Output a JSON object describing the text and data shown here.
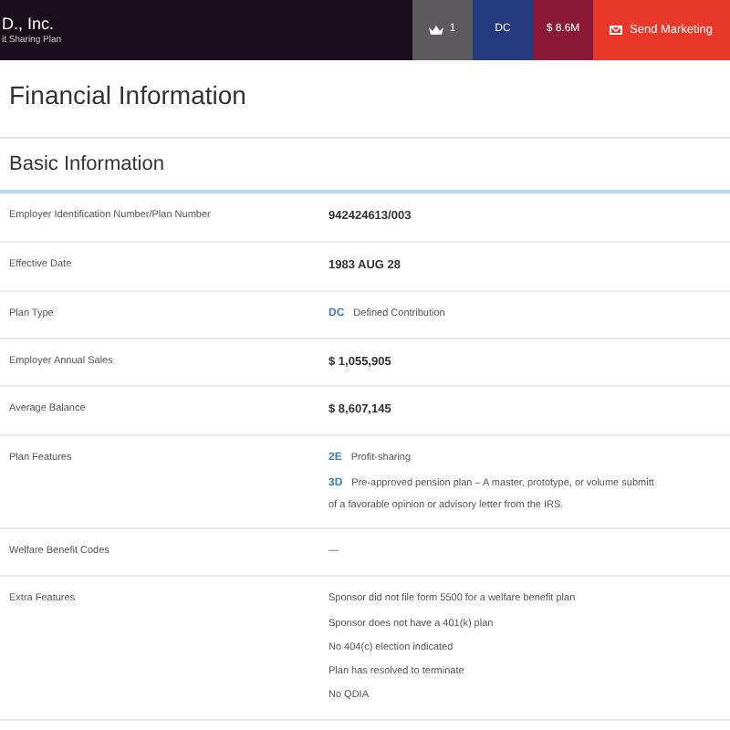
{
  "header": {
    "company": "D., Inc.",
    "plan": "it Sharing Plan",
    "badges": [
      {
        "kind": "count",
        "text": "1"
      },
      {
        "kind": "type",
        "text": "DC"
      },
      {
        "kind": "amount",
        "text": "$ 8.6M"
      }
    ],
    "action": "Send Marketing"
  },
  "title": "Financial Information",
  "section": {
    "title": "Basic Information",
    "rows": [
      {
        "label": "Employer Identification Number/Plan Number",
        "kind": "bold",
        "values": [
          "942424613/003"
        ]
      },
      {
        "label": "Effective Date",
        "kind": "bold",
        "values": [
          "1983 AUG 28"
        ]
      },
      {
        "label": "Plan Type",
        "kind": "coded",
        "codes": [
          {
            "code": "DC",
            "lines": [
              "Defined Contribution"
            ]
          }
        ]
      },
      {
        "label": "Employer Annual Sales",
        "kind": "bold",
        "values": [
          "$ 1,055,905"
        ]
      },
      {
        "label": "Average Balance",
        "kind": "bold",
        "values": [
          "$ 8,607,145"
        ]
      },
      {
        "label": "Plan Features",
        "kind": "coded",
        "codes": [
          {
            "code": "2E",
            "lines": [
              "Profit-sharing"
            ]
          },
          {
            "code": "3D",
            "lines": [
              "Pre-approved pension plan – A master, prototype, or volume submitt",
              "of a favorable opinion or advisory letter from the IRS."
            ]
          }
        ]
      },
      {
        "label": "Welfare Benefit Codes",
        "kind": "plain",
        "values": [
          "—"
        ]
      },
      {
        "label": "Extra Features",
        "kind": "plain",
        "values": [
          "Sponsor did not file form 5500 for a welfare benefit plan",
          "Sponsor does not have a 401(k) plan",
          "No 404(c) election indicated",
          "Plan has resolved to terminate",
          "No QDIA"
        ]
      }
    ]
  }
}
